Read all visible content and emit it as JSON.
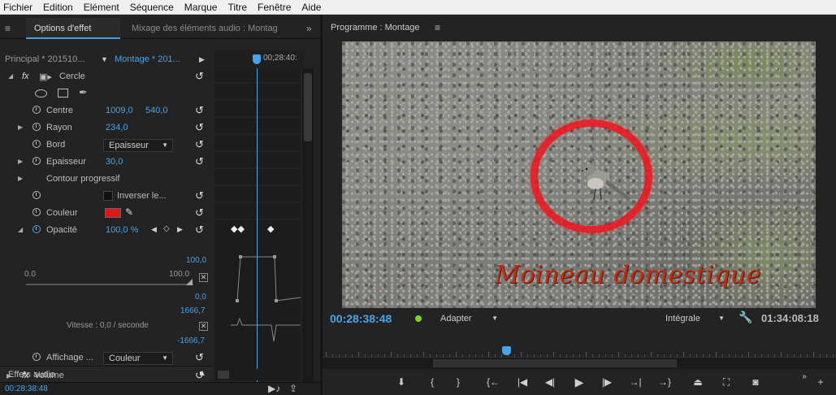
{
  "menu": [
    "Fichier",
    "Edition",
    "Elément",
    "Séquence",
    "Marque",
    "Titre",
    "Fenêtre",
    "Aide"
  ],
  "effects_panel": {
    "tab_active": "Options d'effet",
    "tab_inactive": "Mixage des éléments audio : Montag",
    "tab_menu": "≡",
    "overflow": "»",
    "source_principal": "Principal * 201510...",
    "source_sequence": "Montage * 201...",
    "timecode_ruler": "00;28:40:",
    "effect_name": "Cercle",
    "fx_label": "fx",
    "props": {
      "centre_label": "Centre",
      "centre_x": "1009,0",
      "centre_y": "540,0",
      "rayon_label": "Rayon",
      "rayon_value": "234,0",
      "bord_label": "Bord",
      "bord_value": "Epaisseur",
      "epaisseur_label": "Epaisseur",
      "epaisseur_value": "30,0",
      "contour_label": "Contour progressif",
      "inverser_label": "Inverser le...",
      "couleur_label": "Couleur",
      "opacite_label": "Opacité",
      "opacite_value": "100,0 %",
      "affichage_label": "Affichage ...",
      "affichage_value": "Couleur"
    },
    "graph": {
      "top_max": "100,0",
      "min": "0.0",
      "max": "100.0",
      "bottom_val": "0,0",
      "vel_top": "1666,7",
      "vitesse_label": "Vitesse : 0,0 / seconde",
      "vel_bottom": "-1666,7"
    },
    "audio_section": "Effets audio",
    "volume_label": "Volume",
    "bottom_timecode": "00:28:38:48"
  },
  "program_monitor": {
    "title": "Programme : Montage",
    "menu": "≡",
    "caption": "Moineau domestique",
    "timecode": "00:28:38:48",
    "fit_value": "Adapter",
    "quality_value": "Intégrale",
    "duration": "01:34:08:18"
  },
  "colors": {
    "accent": "#4aa3e8",
    "circle_red": "#e0171a",
    "caption_red": "#b8321a"
  }
}
